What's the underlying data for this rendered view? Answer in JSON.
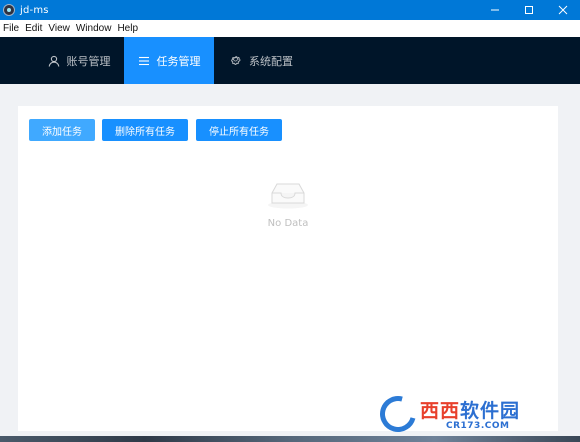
{
  "window": {
    "title": "jd-ms"
  },
  "menu": [
    "File",
    "Edit",
    "View",
    "Window",
    "Help"
  ],
  "nav": {
    "tabs": [
      {
        "label": "账号管理",
        "icon": "user-icon"
      },
      {
        "label": "任务管理",
        "icon": "menu-icon",
        "active": true
      },
      {
        "label": "系统配置",
        "icon": "gear-icon"
      }
    ]
  },
  "toolbar": {
    "add_label": "添加任务",
    "delete_all_label": "删除所有任务",
    "stop_all_label": "停止所有任务"
  },
  "empty_state": {
    "text": "No Data",
    "icon": "inbox-icon"
  },
  "watermark": {
    "brand_a": "西西",
    "brand_b": "软件园",
    "site": "CR173.COM"
  },
  "colors": {
    "accent": "#1890ff",
    "nav_bg": "#001529",
    "titlebar": "#0078d7"
  }
}
